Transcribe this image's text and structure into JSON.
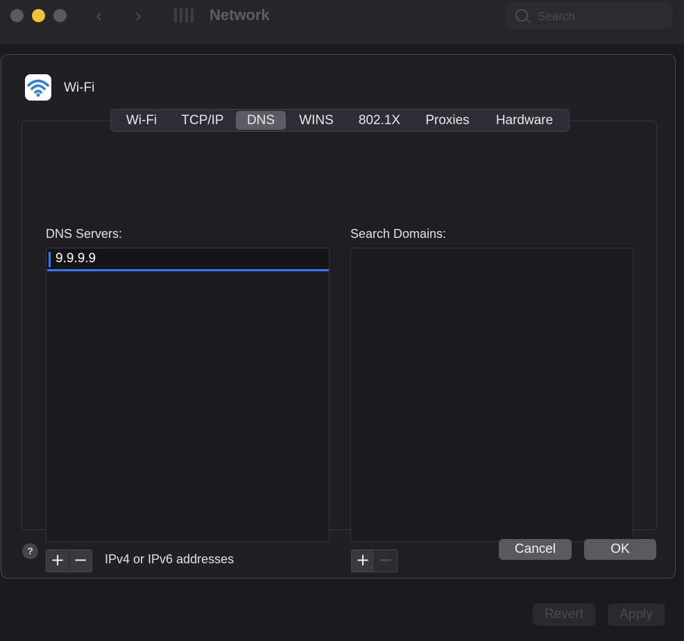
{
  "window": {
    "title": "Network",
    "search_placeholder": "Search",
    "revert_label": "Revert",
    "apply_label": "Apply"
  },
  "sheet": {
    "interface_name": "Wi-Fi",
    "tabs": [
      {
        "label": "Wi-Fi",
        "active": false
      },
      {
        "label": "TCP/IP",
        "active": false
      },
      {
        "label": "DNS",
        "active": true
      },
      {
        "label": "WINS",
        "active": false
      },
      {
        "label": "802.1X",
        "active": false
      },
      {
        "label": "Proxies",
        "active": false
      },
      {
        "label": "Hardware",
        "active": false
      }
    ],
    "dns_servers": {
      "label": "DNS Servers:",
      "entries": [
        "9.9.9.9"
      ],
      "hint": "IPv4 or IPv6 addresses",
      "add_glyph": "+",
      "remove_glyph": "−"
    },
    "search_domains": {
      "label": "Search Domains:",
      "entries": [],
      "add_glyph": "+",
      "remove_glyph": "−"
    },
    "help_glyph": "?",
    "cancel_label": "Cancel",
    "ok_label": "OK"
  },
  "colors": {
    "accent": "#3a7bd5",
    "traffic_yellow": "#f4bf3b",
    "active_tab": "#5d5c62",
    "sheet_bg": "#201f24"
  },
  "icons": {
    "interface": "wifi-icon",
    "help": "help-icon"
  }
}
